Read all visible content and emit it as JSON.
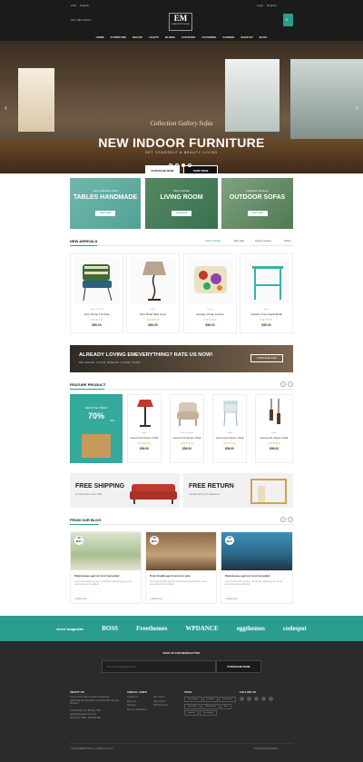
{
  "topbar": {
    "currency": "USD",
    "language": "English",
    "phone": "(01) 198 140679",
    "account": "Login",
    "register": "Register",
    "cart_count": "0",
    "logo": "EM",
    "logo_sub": "EMEVERYTHING"
  },
  "nav": [
    "HOME",
    "FURNITURE",
    "DECOR",
    "LIGHTS",
    "BLINDS",
    "CURTAINS",
    "COVERING",
    "GARDEN",
    "SHOP EP",
    "BLOG"
  ],
  "hero": {
    "subtitle": "Collection Gallery Sofas",
    "title": "NEW INDOOR FURNITURE",
    "tagline": "GET YOURSELF A BEAUTY LIVING",
    "btn1": "PURCHASE NOW",
    "btn2": "SHOP NOW"
  },
  "banners": [
    {
      "pre": "New Collection 2016",
      "title": "TABLES HANDMADE",
      "button": "SHOP NOW"
    },
    {
      "pre": "Stay At Mode",
      "title": "LIVING ROOM",
      "button": "SHOP NOW"
    },
    {
      "pre": "Collection Sunless",
      "title": "OUTDOOR SOFAS",
      "button": "SHOP NOW"
    }
  ],
  "new_arrivals": {
    "title": "NEW ARRIVALS",
    "tabs": [
      "Sofas & Chairs",
      "Best Sale",
      "Lights & Lamps",
      "Tables"
    ],
    "products": [
      {
        "cat": "Sofas & Chairs",
        "name": "Arbor Dining T-ill Chair",
        "stars": "★★★★★",
        "price": "$56.00"
      },
      {
        "cat": "Lights",
        "name": "Floor Metal Table Lamp",
        "stars": "★★★★★",
        "price": "$56.00"
      },
      {
        "cat": "Cushion",
        "name": "Heritage Ornate Cushion",
        "stars": "★★★★★",
        "price": "$56.00"
      },
      {
        "cat": "Tables",
        "name": "Castello Cove Capital Metal",
        "stars": "★★★★★",
        "price": "$56.00"
      }
    ]
  },
  "rate": {
    "title": "ALREADY LOVING EMEVERYTHING? RATE US NOW!",
    "sub": "WE MAKE YOUR DREAM COME TRUE",
    "button": "PURCHASE NOW"
  },
  "feature": {
    "title": "FEATURE PRODUCT",
    "promo_pre": "NEW STYLE TABLES",
    "promo_pct": "70%",
    "promo_off": "OFF",
    "products": [
      {
        "cat": "Lights",
        "name": "Good Luck Cavern Chair",
        "stars": "★★★★★",
        "price": "$56.00"
      },
      {
        "cat": "Sofas & Chairs",
        "name": "Good Luck Cavern Chair",
        "stars": "★★★★★",
        "price": "$56.00"
      },
      {
        "cat": "Tables",
        "name": "Good Luck Cavern Chair",
        "stars": "★★★★★",
        "price": "$56.00"
      },
      {
        "cat": "Lights",
        "name": "Good Luck Cavern Chair",
        "stars": "★★★★★",
        "price": "$56.00"
      }
    ]
  },
  "shipping": [
    {
      "title": "FREE SHIPPING",
      "sub": "on all orders over $50"
    },
    {
      "title": "FREE RETURN",
      "sub": "satisfy with your pleasure"
    }
  ],
  "blog": {
    "title": "FROM OUR BLOG",
    "posts": [
      {
        "day": "26",
        "mon": "MAY",
        "title": "Pellentesque eget nisl mi id met pelled",
        "excerpt": "Lorem ipsum dolor sit amet, consectetur adipiscing elit, sed do eiusmod tempor incididunt.",
        "more": "+ Read more"
      },
      {
        "day": "28",
        "mon": "MAY",
        "title": "Proin fringilla eget lorem id et velle",
        "excerpt": "Lorem ipsum dolor sit amet, consectetur adipiscing elit, sed do eiusmod tempor incididunt.",
        "more": "+ Read more"
      },
      {
        "day": "29",
        "mon": "MAY",
        "title": "Pellentesque eget nisl mi id met pelled",
        "excerpt": "Lorem ipsum dolor sit amet, consectetur adipiscing elit, sed do eiusmod tempor incididunt.",
        "more": "+ Read more"
      }
    ]
  },
  "brands": [
    "street magazine",
    "BOSS",
    "Freethemes",
    "WPDANCE",
    "eggthemes",
    "codespot"
  ],
  "newsletter": {
    "title": "SIGN UP FOR NEWSLETTER",
    "placeholder": "Your email address here...",
    "button": "PURCHASE NOW"
  },
  "footer": {
    "about_title": "ABOUT US",
    "about_text": "Lorem ipsum dolor sit amet consectetur adipiscing elit. Sed diam nonummy nibh euismod tincidunt.",
    "address": "1234 Heaven Str, Beverly Hills",
    "email": "support@typethemes.com",
    "phone": "(01) 234 5 6789 - 234 567 891",
    "useful_title": "USEFUL LINKS",
    "useful": [
      "Contact us",
      "About us",
      "Sitemap",
      "Terms & Conditions"
    ],
    "col3": [
      "Site orders",
      "Wish orders",
      "Wishlist orders"
    ],
    "tags_title": "TAGS",
    "tags": [
      "accessories",
      "beautiful",
      "Fun design",
      "bestsellers",
      "Waterboard",
      "Best",
      "summer",
      "Fun design"
    ],
    "follow_title": "FOLLOW US",
    "copyright": "© 2016 EMEVERYTHING. All Rights Reserved.",
    "payments": "PayPal  VISA  DISCOVER"
  }
}
